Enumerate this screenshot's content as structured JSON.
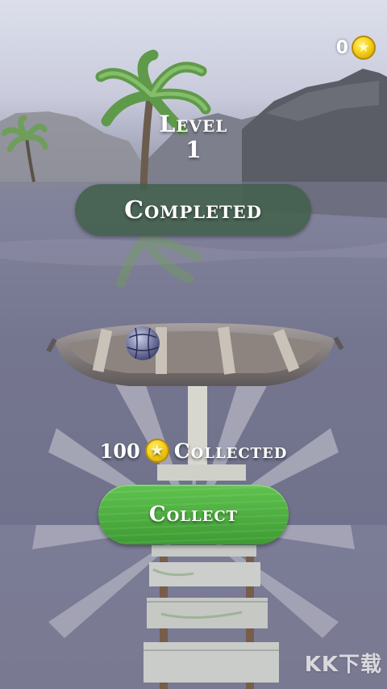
{
  "hud": {
    "coins": "0",
    "coin_icon": "star-coin"
  },
  "level": {
    "word": "Level",
    "number": "1"
  },
  "banner": {
    "status": "Completed"
  },
  "reward": {
    "amount": "100",
    "label": "Collected",
    "coin_icon": "star-coin"
  },
  "actions": {
    "collect_label": "Collect"
  },
  "watermark": "KK下载",
  "colors": {
    "banner_bg": "#42604c",
    "collect_button": "#4fb040",
    "coin": "#f5d21c",
    "water": "#6c6e88"
  }
}
